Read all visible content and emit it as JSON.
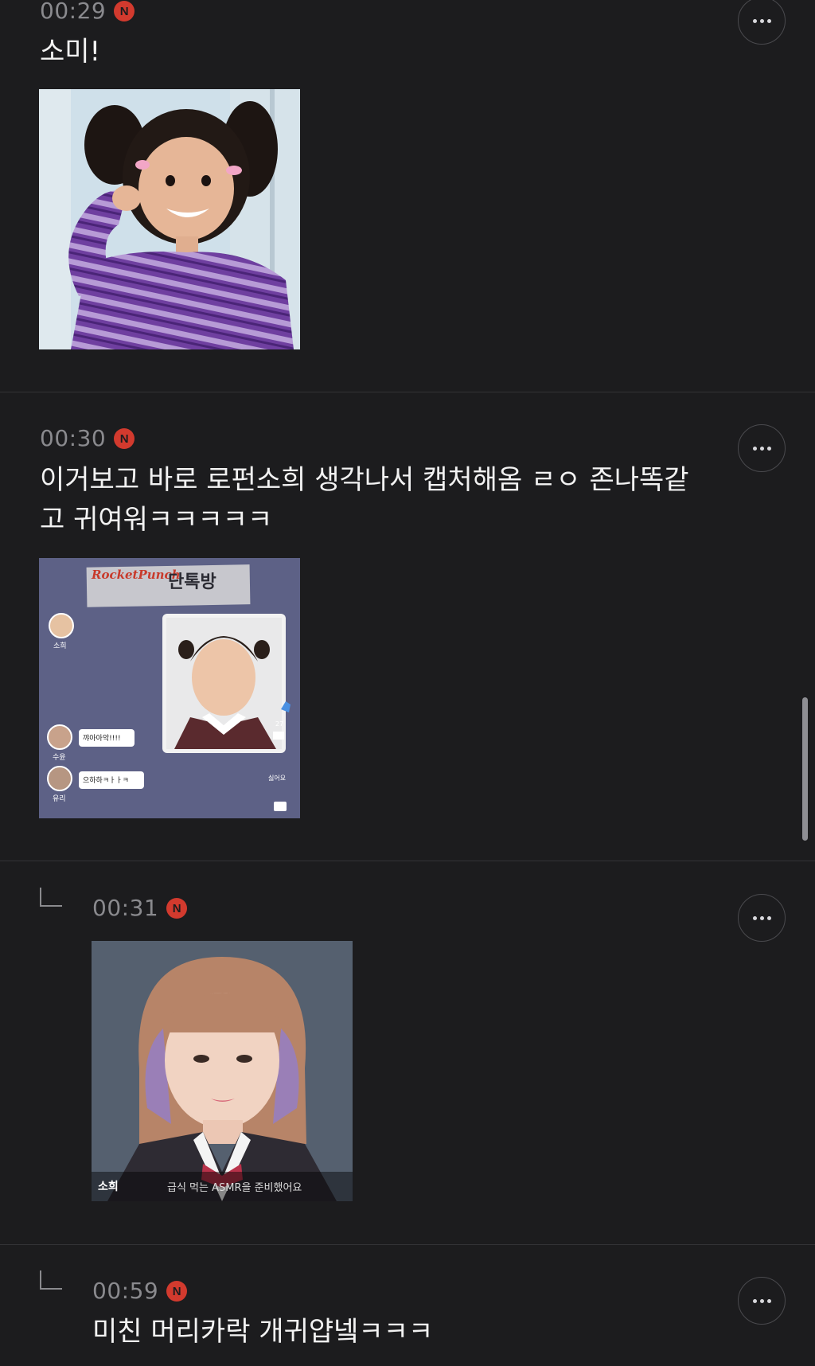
{
  "comments": [
    {
      "time": "00:29",
      "badge": "N",
      "text": "소미!",
      "image_alt": "toddler in purple striped sweater"
    },
    {
      "time": "00:30",
      "badge": "N",
      "text_line1": "이거보고 바로 로펀소희 생각나서 캡처해옴 ㄹㅇ 존나똑같",
      "text_line2": "고 귀여워ㅋㅋㅋㅋㅋ",
      "image": {
        "logo_text": "RocketPunch",
        "title": "단톡방",
        "user1": "소희",
        "user2": "수윤",
        "user2_msg": "꺄아아악!!!!",
        "user3": "유리",
        "user3_msg": "으하하ㅋㅏㅏㅋ",
        "like_count": "27",
        "dislike_label": "싫어요"
      }
    },
    {
      "time": "00:31",
      "badge": "N",
      "image": {
        "name_caption": "소희",
        "subtitle": "급식 먹는 ASMR을 준비했어요"
      }
    },
    {
      "time": "00:59",
      "badge": "N",
      "text": "미친 머리카락 개귀얍넼ㅋㅋㅋ"
    }
  ],
  "icons": {
    "more": "more-horizontal-icon",
    "reply": "reply-arrow-icon"
  },
  "colors": {
    "background": "#1c1c1e",
    "badge": "#d23a2e",
    "time": "#8a8a8e",
    "text": "#f2f2f2"
  }
}
